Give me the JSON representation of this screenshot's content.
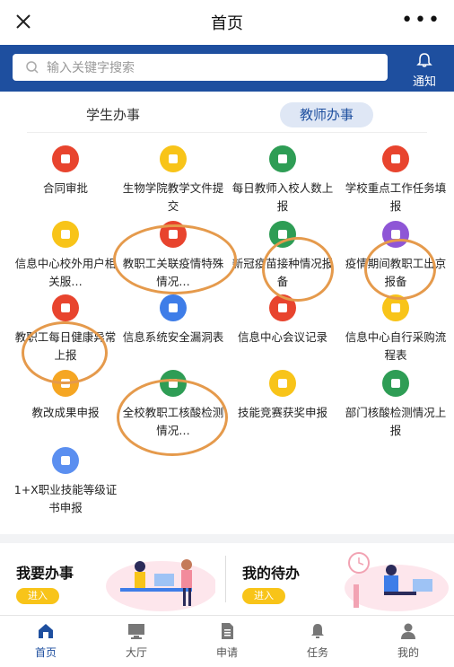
{
  "header": {
    "title": "首页"
  },
  "search": {
    "placeholder": "输入关键字搜索",
    "notify_label": "通知"
  },
  "tabs": [
    {
      "label": "学生办事",
      "active": false
    },
    {
      "label": "教师办事",
      "active": true
    }
  ],
  "services": [
    {
      "label": "合同审批",
      "icon": "stamp-icon",
      "color": "#e8442e"
    },
    {
      "label": "生物学院教学文件提交",
      "icon": "notebook-icon",
      "color": "#f8c419"
    },
    {
      "label": "每日教师入校人数上报",
      "icon": "teacher-icon",
      "color": "#2e9d55"
    },
    {
      "label": "学校重点工作任务填报",
      "icon": "target-icon",
      "color": "#e8442e"
    },
    {
      "label": "信息中心校外用户相关服…",
      "icon": "document-icon",
      "color": "#f8c419"
    },
    {
      "label": "教职工关联疫情特殊情况…",
      "icon": "megaphone-icon",
      "color": "#e8442e"
    },
    {
      "label": "新冠疫苗接种情况报备",
      "icon": "person-search-icon",
      "color": "#2e9d55"
    },
    {
      "label": "疫情期间教职工出京报备",
      "icon": "person-icon",
      "color": "#8e56d6"
    },
    {
      "label": "教职工每日健康异常上报",
      "icon": "home-icon",
      "color": "#e8442e"
    },
    {
      "label": "信息系统安全漏洞表",
      "icon": "server-icon",
      "color": "#3e7de8"
    },
    {
      "label": "信息中心会议记录",
      "icon": "pencil-icon",
      "color": "#e8442e"
    },
    {
      "label": "信息中心自行采购流程表",
      "icon": "clipboard-icon",
      "color": "#f8c419"
    },
    {
      "label": "教改成果申报",
      "icon": "badge-icon",
      "color": "#f5a623"
    },
    {
      "label": "全校教职工核酸检测情况…",
      "icon": "book-icon",
      "color": "#2e9d55"
    },
    {
      "label": "技能竞赛获奖申报",
      "icon": "trophy-icon",
      "color": "#f8c419"
    },
    {
      "label": "部门核酸检测情况上报",
      "icon": "folder-icon",
      "color": "#2e9d55"
    },
    {
      "label": "1+X职业技能等级证书申报",
      "icon": "certificate-icon",
      "color": "#5b8ff0"
    }
  ],
  "cards": [
    {
      "title": "我要办事",
      "button": "进入"
    },
    {
      "title": "我的待办",
      "button": "进入"
    }
  ],
  "tabbar": [
    {
      "label": "首页",
      "icon": "home-icon",
      "active": true
    },
    {
      "label": "大厅",
      "icon": "monitor-icon",
      "active": false
    },
    {
      "label": "申请",
      "icon": "document-icon",
      "active": false
    },
    {
      "label": "任务",
      "icon": "bell-icon",
      "active": false
    },
    {
      "label": "我的",
      "icon": "user-icon",
      "active": false
    }
  ]
}
